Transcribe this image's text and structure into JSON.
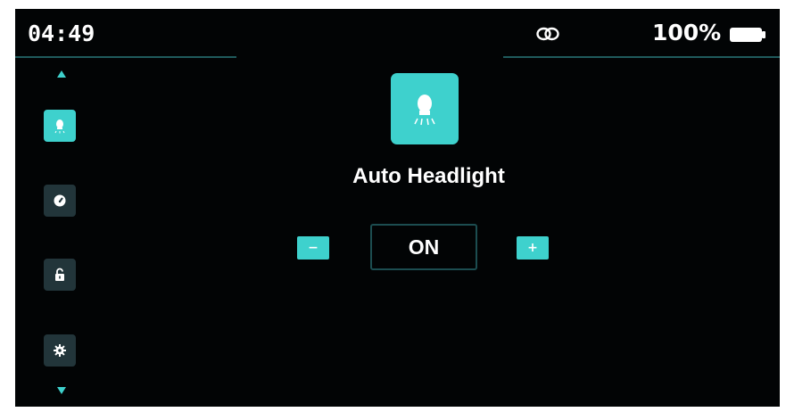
{
  "status_bar": {
    "time": "04:49",
    "link_icon": "link-icon",
    "battery_percent": "100%",
    "battery_icon": "battery-full-icon"
  },
  "sidebar": {
    "items": [
      {
        "id": "headlight",
        "icon": "headlight-icon",
        "active": true
      },
      {
        "id": "speedometer",
        "icon": "gauge-icon",
        "active": false
      },
      {
        "id": "lock",
        "icon": "unlock-icon",
        "active": false
      },
      {
        "id": "settings",
        "icon": "gear-icon",
        "active": false
      }
    ]
  },
  "main": {
    "feature_icon": "headlight-icon",
    "title": "Auto Headlight",
    "stepper": {
      "minus_label": "−",
      "value": "ON",
      "plus_label": "+"
    }
  },
  "colors": {
    "accent": "#3ed1cd",
    "background": "#020405",
    "inactive_tile": "#22353a",
    "divider": "#1f5a5c"
  }
}
